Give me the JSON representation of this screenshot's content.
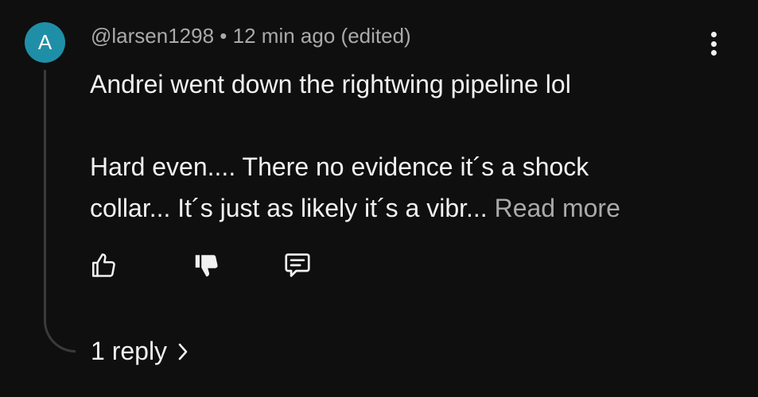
{
  "comment": {
    "avatar_letter": "A",
    "avatar_color": "#1f8fa7",
    "author": "@larsen1298",
    "separator": "•",
    "time": "12 min ago",
    "edited": "(edited)",
    "line1": "Andrei went down the rightwing pipeline lol",
    "line2": "Hard even.... There no evidence it´s a shock",
    "line3": "collar... It´s just as likely it´s a vibr...",
    "read_more": "Read more"
  },
  "actions": {
    "like_icon": "thumbs-up-icon",
    "dislike_icon": "thumbs-down-icon",
    "reply_icon": "comment-icon",
    "more_icon": "more-vertical-icon"
  },
  "replies": {
    "label": "1 reply",
    "icon": "chevron-right-icon"
  },
  "colors": {
    "background": "#0f0f0f",
    "text": "#f1f1f1",
    "secondary": "#aaaaaa"
  }
}
